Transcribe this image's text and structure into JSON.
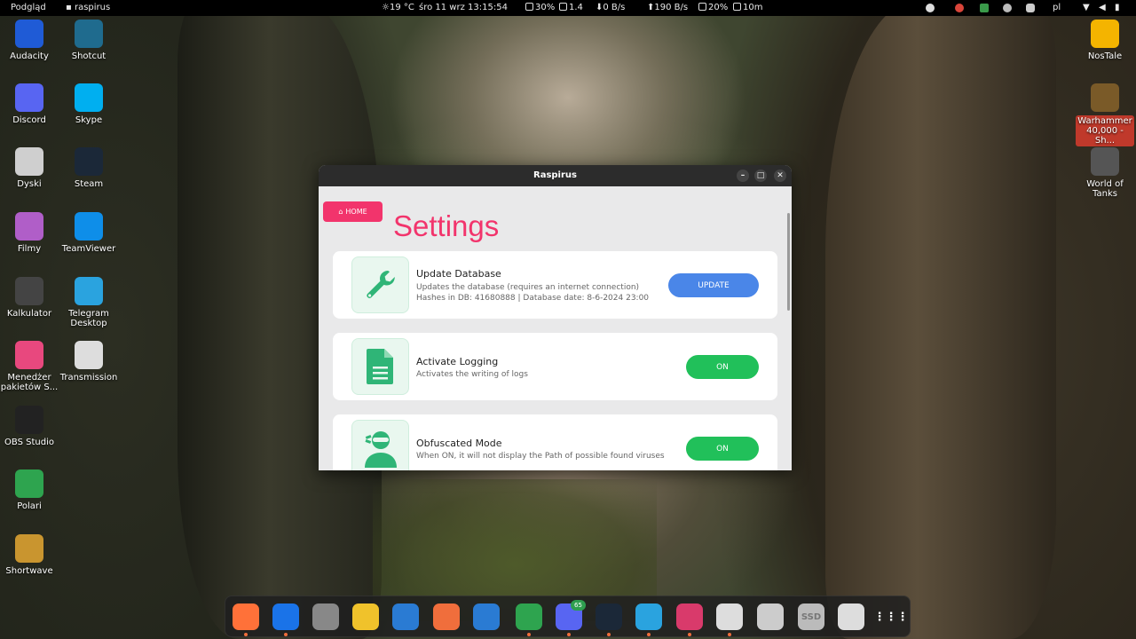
{
  "topbar": {
    "activities": "Podgląd",
    "app": "raspirus",
    "weather": "19 °C",
    "datetime": "śro 11 wrz  13:15:54",
    "cpu": "30%",
    "load": "1.4",
    "net_down": "0 B/s",
    "net_up": "190 B/s",
    "mem": "20%",
    "uptime": "10m",
    "lang": "pl"
  },
  "desktop": {
    "left": [
      {
        "label": "Audacity",
        "icon": "audacity-icon",
        "color": "#1f5bd6"
      },
      {
        "label": "Shotcut",
        "icon": "shotcut-icon",
        "color": "#1f6b8e"
      },
      {
        "label": "Discord",
        "icon": "discord-icon",
        "color": "#5865f2"
      },
      {
        "label": "Skype",
        "icon": "skype-icon",
        "color": "#00aff0"
      },
      {
        "label": "Dyski",
        "icon": "disks-icon",
        "color": "#cfcfcf"
      },
      {
        "label": "Steam",
        "icon": "steam-icon",
        "color": "#1b2838"
      },
      {
        "label": "Filmy",
        "icon": "videos-icon",
        "color": "#b05ec8"
      },
      {
        "label": "TeamViewer",
        "icon": "teamviewer-icon",
        "color": "#0e8ee9"
      },
      {
        "label": "Kalkulator",
        "icon": "calculator-icon",
        "color": "#444444"
      },
      {
        "label": "Telegram Desktop",
        "icon": "telegram-icon",
        "color": "#2aa3df"
      },
      {
        "label": "Menedżer pakietów S...",
        "icon": "package-manager-icon",
        "color": "#e8487e"
      },
      {
        "label": "Transmission",
        "icon": "transmission-icon",
        "color": "#dddddd"
      },
      {
        "label": "OBS Studio",
        "icon": "obs-icon",
        "color": "#222222"
      },
      {
        "label": "Polari",
        "icon": "polari-icon",
        "color": "#2ea44f"
      },
      {
        "label": "Shortwave",
        "icon": "shortwave-icon",
        "color": "#c9952f"
      }
    ],
    "right": [
      {
        "label": "NosTale",
        "icon": "nostale-icon",
        "color": "#f4b400"
      },
      {
        "label": "Warhammer 40,000 - Sh...",
        "icon": "warhammer-icon",
        "color": "#7a5a28"
      },
      {
        "label": "World of Tanks",
        "icon": "world-of-tanks-icon",
        "color": "#555555"
      }
    ]
  },
  "window": {
    "title": "Raspirus",
    "home_label": "HOME",
    "page_title": "Settings",
    "cards": [
      {
        "title": "Update Database",
        "desc1": "Updates the database (requires an internet connection)",
        "desc2": "Hashes in DB: 41680888 | Database date: 8-6-2024 23:00",
        "button": "UPDATE",
        "icon": "wrench-icon",
        "button_color": "#4a86e8"
      },
      {
        "title": "Activate Logging",
        "desc1": "Activates the writing of logs",
        "button": "ON",
        "icon": "document-icon",
        "button_color": "#21c05a"
      },
      {
        "title": "Obfuscated Mode",
        "desc1": "When ON, it will not display the Path of possible found viruses",
        "button": "ON",
        "icon": "masked-user-icon",
        "button_color": "#21c05a"
      }
    ]
  },
  "dock": {
    "items": [
      {
        "name": "firefox-icon",
        "color": "#ff7139"
      },
      {
        "name": "thunderbird-icon",
        "color": "#1a73e8"
      },
      {
        "name": "files-icon",
        "color": "#888888"
      },
      {
        "name": "rhythmbox-icon",
        "color": "#f0c22b"
      },
      {
        "name": "writer-icon",
        "color": "#2a7bd3"
      },
      {
        "name": "app-center-icon",
        "color": "#f06e3c"
      },
      {
        "name": "help-icon",
        "color": "#2a7bd3"
      },
      {
        "name": "polari-icon",
        "color": "#2ea44f"
      },
      {
        "name": "discord-icon",
        "color": "#5865f2"
      },
      {
        "name": "steam-icon",
        "color": "#1b2838"
      },
      {
        "name": "telegram-icon",
        "color": "#2aa3df"
      },
      {
        "name": "raspirus-icon",
        "color": "#d93a6b"
      },
      {
        "name": "transmission-icon",
        "color": "#dddddd"
      },
      {
        "name": "drive-icon",
        "color": "#cccccc"
      },
      {
        "name": "ssd-icon",
        "color": "#bbbbbb"
      },
      {
        "name": "trash-icon",
        "color": "#dddddd"
      },
      {
        "name": "app-grid-icon",
        "color": "#ffffff"
      }
    ],
    "discord_badge": "65",
    "ssd_label": "SSD"
  }
}
